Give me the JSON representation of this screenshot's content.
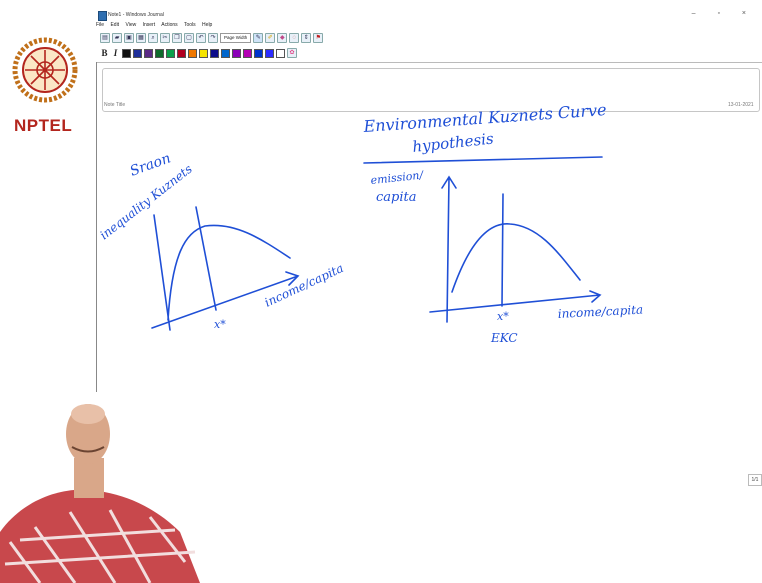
{
  "window": {
    "title": "Note1 - Windows Journal",
    "controls": "– ▫ ×"
  },
  "logo": {
    "text": "NPTEL"
  },
  "menu": [
    "File",
    "Edit",
    "View",
    "Insert",
    "Actions",
    "Tools",
    "Help"
  ],
  "toolbar": {
    "zoom_label": "Page Width"
  },
  "pen_colors": [
    "#111111",
    "#1f2f9a",
    "#5b2a86",
    "#0f6b2c",
    "#0aa04a",
    "#b00020",
    "#f07800",
    "#f5e400",
    "#0d0d8a",
    "#0066cc",
    "#8b00b8",
    "#b400b4",
    "#0033cc",
    "#2c2cff",
    "#ffffff"
  ],
  "note": {
    "title_label": "Note Title",
    "date": "13-01-2021",
    "page": "1/1"
  },
  "ink": {
    "left_ylabel_1": "Sraon",
    "left_ylabel_2": "inequality Kuznets",
    "left_xlabel": "income/capita",
    "left_xstar": "x*",
    "heading_1": "Environmental Kuznets Curve",
    "heading_2": "hypothesis",
    "right_ylabel_1": "emission/",
    "right_ylabel_2": "capita",
    "right_xlabel": "income/capita",
    "right_xstar": "x*",
    "right_caption": "EKC"
  }
}
